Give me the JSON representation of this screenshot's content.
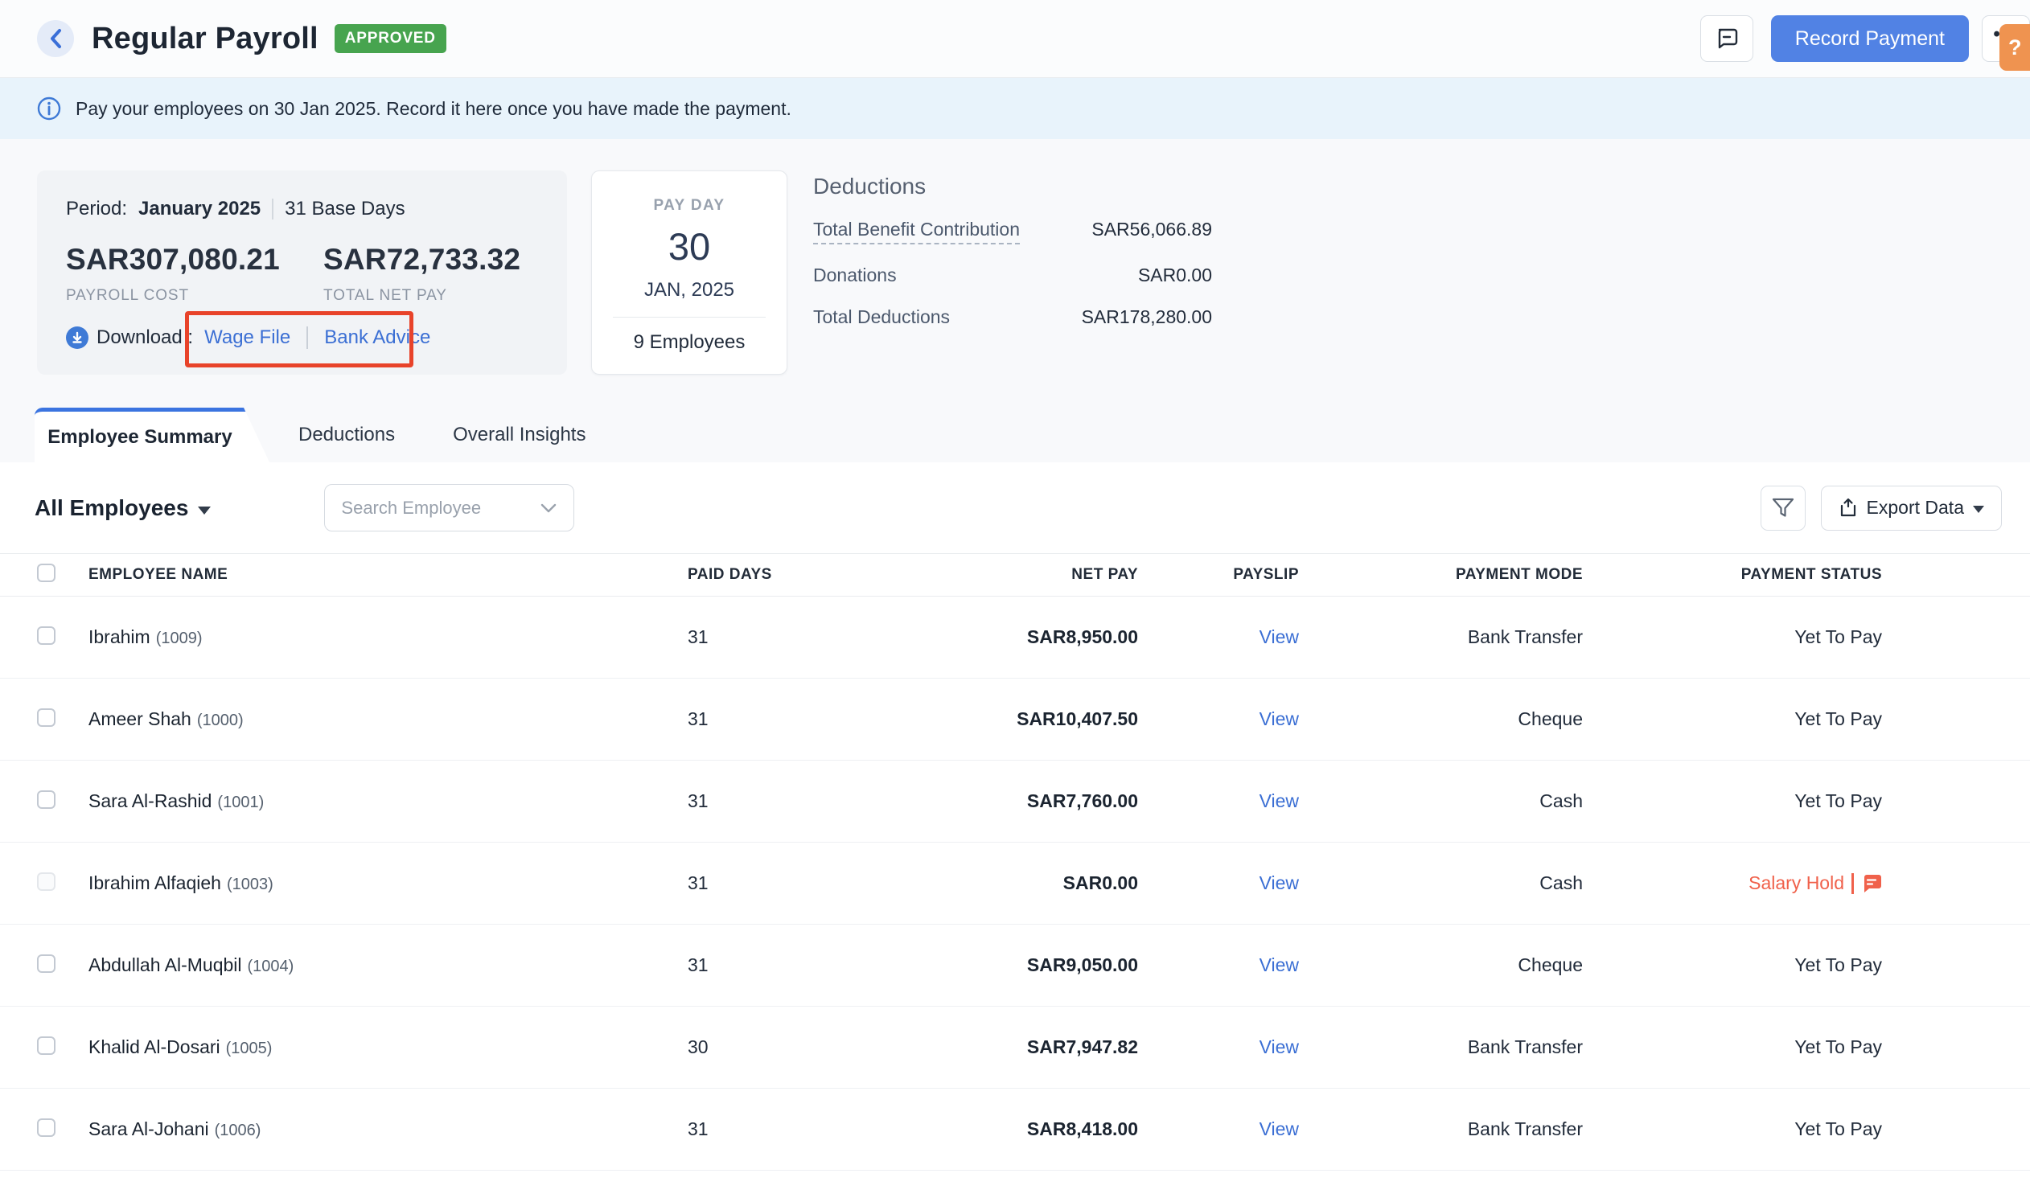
{
  "header": {
    "title": "Regular Payroll",
    "status_badge": "APPROVED",
    "record_payment_label": "Record Payment",
    "more_label": "•••",
    "help_label": "?"
  },
  "banner": {
    "text": "Pay your employees on 30 Jan 2025. Record it here once you have made the payment."
  },
  "summary": {
    "period_label": "Period:",
    "period_value": "January 2025",
    "base_days": "31 Base Days",
    "payroll_cost": "SAR307,080.21",
    "payroll_cost_label": "PAYROLL COST",
    "total_net_pay": "SAR72,733.32",
    "total_net_pay_label": "TOTAL NET PAY",
    "download_label": "Download :",
    "download_links": {
      "wage_file": "Wage File",
      "bank_advice": "Bank Advice"
    }
  },
  "payday": {
    "label": "PAY DAY",
    "day": "30",
    "month_year": "JAN, 2025",
    "employees": "9 Employees"
  },
  "deductions": {
    "title": "Deductions",
    "rows": [
      {
        "label": "Total Benefit Contribution",
        "value": "SAR56,066.89"
      },
      {
        "label": "Donations",
        "value": "SAR0.00"
      },
      {
        "label": "Total Deductions",
        "value": "SAR178,280.00"
      }
    ]
  },
  "tabs": [
    {
      "label": "Employee Summary",
      "active": true
    },
    {
      "label": "Deductions",
      "active": false
    },
    {
      "label": "Overall Insights",
      "active": false
    }
  ],
  "filters": {
    "employee_filter": "All Employees",
    "search_placeholder": "Search Employee",
    "export_label": "Export Data"
  },
  "table": {
    "columns": [
      "EMPLOYEE NAME",
      "PAID DAYS",
      "NET PAY",
      "PAYSLIP",
      "PAYMENT MODE",
      "PAYMENT STATUS"
    ],
    "rows": [
      {
        "name": "Ibrahim",
        "id": "(1009)",
        "paid_days": "31",
        "net_pay": "SAR8,950.00",
        "payslip": "View",
        "payment_mode": "Bank Transfer",
        "payment_status": "Yet To Pay"
      },
      {
        "name": "Ameer Shah",
        "id": "(1000)",
        "paid_days": "31",
        "net_pay": "SAR10,407.50",
        "payslip": "View",
        "payment_mode": "Cheque",
        "payment_status": "Yet To Pay"
      },
      {
        "name": "Sara Al-Rashid",
        "id": "(1001)",
        "paid_days": "31",
        "net_pay": "SAR7,760.00",
        "payslip": "View",
        "payment_mode": "Cash",
        "payment_status": "Yet To Pay"
      },
      {
        "name": "Ibrahim Alfaqieh",
        "id": "(1003)",
        "paid_days": "31",
        "net_pay": "SAR0.00",
        "payslip": "View",
        "payment_mode": "Cash",
        "payment_status": "Salary Hold"
      },
      {
        "name": "Abdullah Al-Muqbil",
        "id": "(1004)",
        "paid_days": "31",
        "net_pay": "SAR9,050.00",
        "payslip": "View",
        "payment_mode": "Cheque",
        "payment_status": "Yet To Pay"
      },
      {
        "name": "Khalid Al-Dosari",
        "id": "(1005)",
        "paid_days": "30",
        "net_pay": "SAR7,947.82",
        "payslip": "View",
        "payment_mode": "Bank Transfer",
        "payment_status": "Yet To Pay"
      },
      {
        "name": "Sara Al-Johani",
        "id": "(1006)",
        "paid_days": "31",
        "net_pay": "SAR8,418.00",
        "payslip": "View",
        "payment_mode": "Bank Transfer",
        "payment_status": "Yet To Pay"
      }
    ]
  },
  "colors": {
    "accent_blue": "#5182e4",
    "link_blue": "#3b6fd4",
    "approved_green": "#47a44f",
    "banner_blue_bg": "#e8f3fb",
    "annotation_red": "#e8432a",
    "salary_hold_orange": "#f0614b",
    "help_orange": "#ef9350"
  }
}
